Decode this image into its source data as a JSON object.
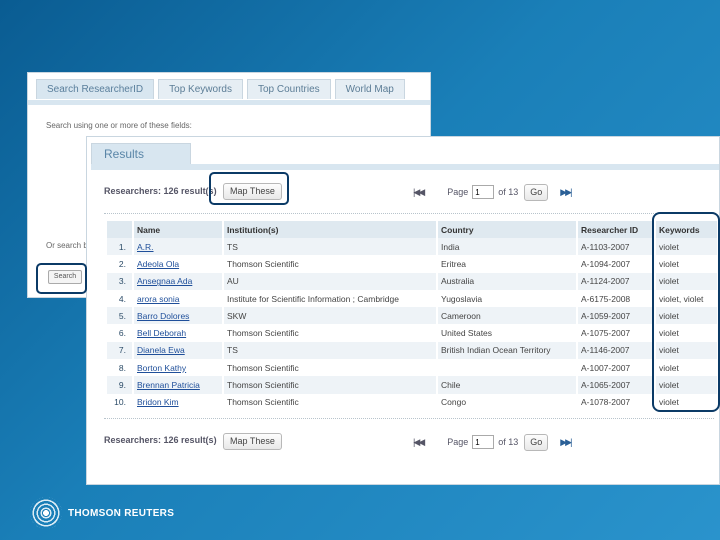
{
  "search_panel": {
    "tabs": [
      {
        "label": "Search ResearcherID"
      },
      {
        "label": "Top Keywords"
      },
      {
        "label": "Top Countries"
      },
      {
        "label": "World Map"
      }
    ],
    "hint": "Search using one or more of these fields:",
    "orcid_note": "Or search b",
    "search_button": "Search"
  },
  "results": {
    "tab_label": "Results",
    "summary_top": "Researchers: 126 result(s)",
    "summary_bottom": "Researchers: 126 result(s)",
    "map_button": "Map These",
    "pager": {
      "first_icon": "first-page-icon",
      "next_icon": "next-page-icon",
      "page_label": "Page",
      "page_value": "1",
      "of_label": "of 13",
      "go_label": "Go"
    },
    "columns": [
      "Name",
      "Institution(s)",
      "Country",
      "Researcher ID",
      "Keywords"
    ],
    "rows": [
      {
        "n": "1.",
        "name": "A.R.",
        "inst": "TS",
        "country": "India",
        "rid": "A-1103-2007",
        "kw": "violet",
        "link": false
      },
      {
        "n": "2.",
        "name": "Adeola Ola",
        "inst": "Thomson Scientific",
        "country": "Eritrea",
        "rid": "A-1094-2007",
        "kw": "violet",
        "link": true
      },
      {
        "n": "3.",
        "name": "Ansegnaa Ada",
        "inst": "AU",
        "country": "Australia",
        "rid": "A-1124-2007",
        "kw": "violet",
        "link": true
      },
      {
        "n": "4.",
        "name": "arora sonia",
        "inst": "Institute for Scientific Information ; Cambridge",
        "country": "Yugoslavia",
        "rid": "A-6175-2008",
        "kw": "violet, violet",
        "link": true
      },
      {
        "n": "5.",
        "name": "Barro Dolores",
        "inst": "SKW",
        "country": "Cameroon",
        "rid": "A-1059-2007",
        "kw": "violet",
        "link": false
      },
      {
        "n": "6.",
        "name": "Bell Deborah",
        "inst": "Thomson Scientific",
        "country": "United States",
        "rid": "A-1075-2007",
        "kw": "violet",
        "link": true
      },
      {
        "n": "7.",
        "name": "Dianela Ewa",
        "inst": "TS",
        "country": "British Indian Ocean Territory",
        "rid": "A-1146-2007",
        "kw": "violet",
        "link": true
      },
      {
        "n": "8.",
        "name": "Borton Kathy",
        "inst": "Thomson Scientific",
        "country": "",
        "rid": "A-1007-2007",
        "kw": "violet",
        "link": true
      },
      {
        "n": "9.",
        "name": "Brennan Patricia",
        "inst": "Thomson Scientific",
        "country": "Chile",
        "rid": "A-1065-2007",
        "kw": "violet",
        "link": false
      },
      {
        "n": "10.",
        "name": "Bridon Kim",
        "inst": "Thomson Scientific",
        "country": "Congo",
        "rid": "A-1078-2007",
        "kw": "violet",
        "link": true
      }
    ]
  },
  "brand": {
    "name": "THOMSON REUTERS",
    "logo_icon": "thomson-reuters-logo-icon"
  },
  "colors": {
    "background": "#1a7fb8",
    "highlight_border": "#0b3a66",
    "header_row": "#dfe9f0",
    "link": "#1f4f9a"
  }
}
